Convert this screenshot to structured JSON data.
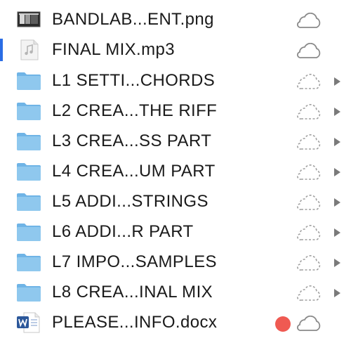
{
  "colors": {
    "folder": "#8fc8ee",
    "folder_dark": "#6fb4e6",
    "accent": "#2b6de5",
    "tag_red": "#ef5a52",
    "cloud_stroke": "#8a8a8a"
  },
  "files": [
    {
      "name": "BANDLAB...ENT.png",
      "kind": "image",
      "icon": "image-file-icon",
      "cloud": "downloaded"
    },
    {
      "name": "FINAL MIX.mp3",
      "kind": "audio",
      "icon": "audio-file-icon",
      "cloud": "downloaded"
    },
    {
      "name": "L1 SETTI...CHORDS",
      "kind": "folder",
      "icon": "folder-icon",
      "cloud": "not-downloaded"
    },
    {
      "name": "L2 CREA...THE RIFF",
      "kind": "folder",
      "icon": "folder-icon",
      "cloud": "not-downloaded"
    },
    {
      "name": "L3 CREA...SS PART",
      "kind": "folder",
      "icon": "folder-icon",
      "cloud": "not-downloaded"
    },
    {
      "name": "L4 CREA...UM PART",
      "kind": "folder",
      "icon": "folder-icon",
      "cloud": "not-downloaded"
    },
    {
      "name": "L5 ADDI...STRINGS",
      "kind": "folder",
      "icon": "folder-icon",
      "cloud": "not-downloaded"
    },
    {
      "name": "L6 ADDI...R PART",
      "kind": "folder",
      "icon": "folder-icon",
      "cloud": "not-downloaded"
    },
    {
      "name": "L7 IMPO...SAMPLES",
      "kind": "folder",
      "icon": "folder-icon",
      "cloud": "not-downloaded"
    },
    {
      "name": "L8 CREA...INAL MIX",
      "kind": "folder",
      "icon": "folder-icon",
      "cloud": "not-downloaded"
    },
    {
      "name": "PLEASE...INFO.docx",
      "kind": "word",
      "icon": "word-doc-icon",
      "cloud": "downloaded",
      "tag": "red"
    }
  ]
}
